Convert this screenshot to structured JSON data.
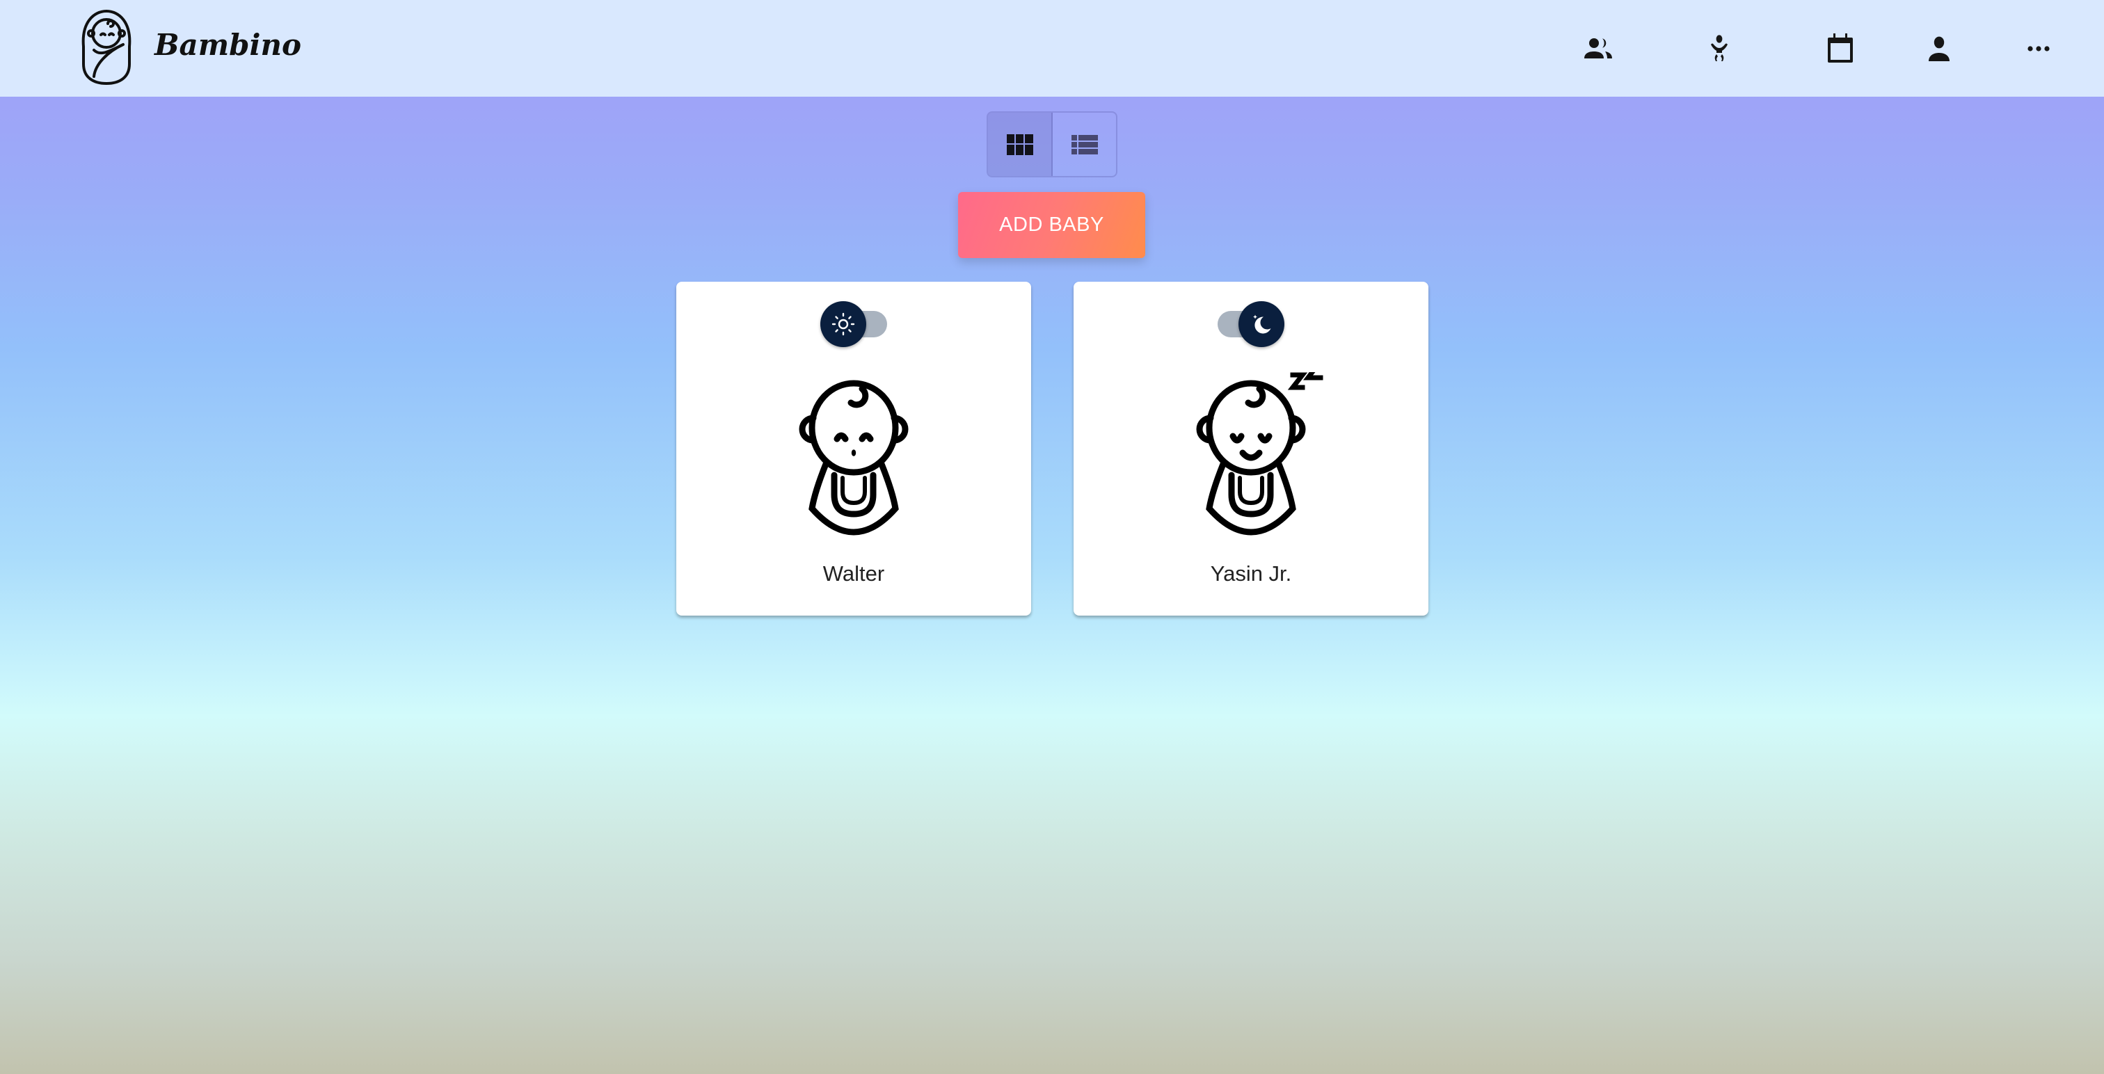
{
  "app": {
    "brand": "Bambino"
  },
  "header": {
    "nav": [
      {
        "icon": "people-icon"
      },
      {
        "icon": "baby-icon"
      },
      {
        "icon": "calendar-icon"
      },
      {
        "icon": "person-icon"
      },
      {
        "icon": "more-icon"
      }
    ]
  },
  "view_toggle": {
    "options": [
      {
        "icon": "grid-icon",
        "active": true
      },
      {
        "icon": "list-icon",
        "active": false
      }
    ]
  },
  "add_button": {
    "label": "ADD BABY"
  },
  "babies": [
    {
      "name": "Walter",
      "mode": "day",
      "asleep": false
    },
    {
      "name": "Yasin Jr.",
      "mode": "night",
      "asleep": true
    }
  ],
  "colors": {
    "accent_start": "#ff6a8a",
    "accent_end": "#ff8c4c",
    "header": "#d9e8fe",
    "knob": "#0a1f3e"
  }
}
